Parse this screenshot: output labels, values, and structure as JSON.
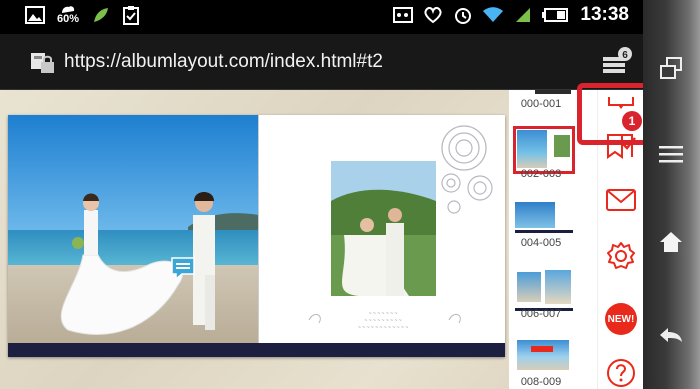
{
  "status_bar": {
    "battery_saver_text": "60%",
    "clock": "13:38"
  },
  "url_bar": {
    "url": "https://albumlayout.com/index.html#t2",
    "tab_count": "6"
  },
  "album": {
    "caption_lines": [
      "~ ~ ~ ~ ~ ~ ~",
      "~ ~ ~ ~ ~ ~ ~ ~ ~",
      "~ ~ ~ ~ ~ ~ ~ ~ ~ ~ ~ ~"
    ]
  },
  "thumbnails": [
    {
      "label": "000-001"
    },
    {
      "label": "002-003"
    },
    {
      "label": "004-005"
    },
    {
      "label": "006-007"
    },
    {
      "label": "008-009"
    }
  ],
  "actions": {
    "mail_badge": "1",
    "new_label": "NEW!"
  },
  "colors": {
    "accent_red": "#d9242d",
    "album_band": "#1c1f3f"
  }
}
